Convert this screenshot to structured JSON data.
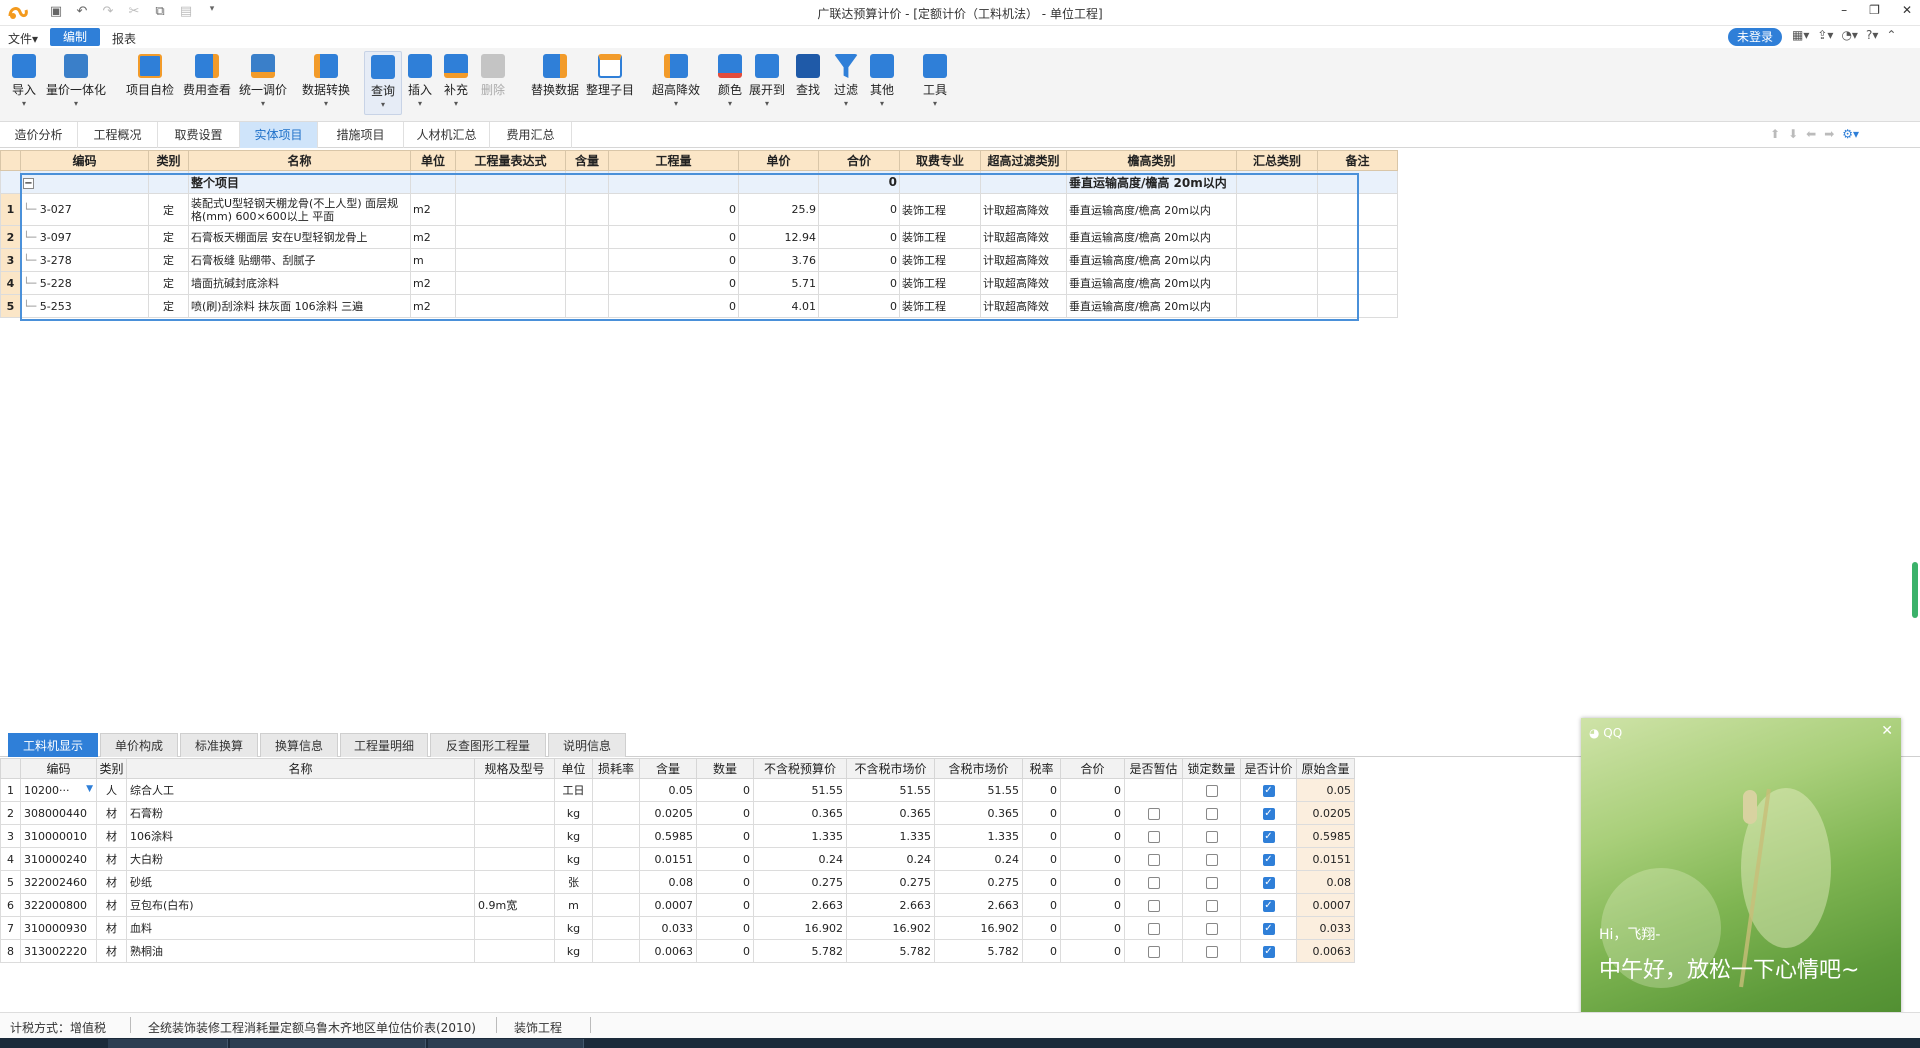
{
  "titlebar": {
    "title": "广联达预算计价 - [定额计价（工料机法） - 单位工程]",
    "min": "–",
    "max": "❐",
    "close": "✕"
  },
  "menubar": {
    "file": "文件▾",
    "edit": "编制",
    "report": "报表",
    "login": "未登录"
  },
  "toolbar": {
    "import": "导入",
    "quote": "量价一体化",
    "selfcheck": "项目自检",
    "feecheck": "费用查看",
    "unify": "统一调价",
    "convert": "数据转换",
    "query": "查询",
    "insert": "插入",
    "supplement": "补充",
    "delete": "删除",
    "replace": "替换数据",
    "organize": "整理子目",
    "superhigh": "超高降效",
    "color": "颜色",
    "expand": "展开到",
    "find": "查找",
    "filter": "过滤",
    "other": "其他",
    "tools": "工具"
  },
  "navtabs": {
    "t0": "造价分析",
    "t1": "工程概况",
    "t2": "取费设置",
    "t3": "实体项目",
    "t4": "措施项目",
    "t5": "人材机汇总",
    "t6": "费用汇总"
  },
  "main": {
    "headers": [
      "编码",
      "类别",
      "名称",
      "单位",
      "工程量表达式",
      "含量",
      "工程量",
      "单价",
      "合价",
      "取费专业",
      "超高过滤类别",
      "檐高类别",
      "汇总类别",
      "备注"
    ],
    "group": {
      "toggle": "−",
      "name": "整个项目",
      "total": "0",
      "eave": "垂直运输高度/檐高 20m以内"
    },
    "rows": [
      {
        "rn": "1",
        "code": "3-027",
        "type": "定",
        "name": "装配式U型轻钢天棚龙骨(不上人型) 面层规格(mm) 600×600以上 平面",
        "unit": "m2",
        "qty": "0",
        "price": "25.9",
        "total": "0",
        "major": "装饰工程",
        "filter": "计取超高降效",
        "eave": "垂直运输高度/檐高 20m以内"
      },
      {
        "rn": "2",
        "code": "3-097",
        "type": "定",
        "name": "石膏板天棚面层 安在U型轻钢龙骨上",
        "unit": "m2",
        "qty": "0",
        "price": "12.94",
        "total": "0",
        "major": "装饰工程",
        "filter": "计取超高降效",
        "eave": "垂直运输高度/檐高 20m以内"
      },
      {
        "rn": "3",
        "code": "3-278",
        "type": "定",
        "name": "石膏板缝 贴绷带、刮腻子",
        "unit": "m",
        "qty": "0",
        "price": "3.76",
        "total": "0",
        "major": "装饰工程",
        "filter": "计取超高降效",
        "eave": "垂直运输高度/檐高 20m以内"
      },
      {
        "rn": "4",
        "code": "5-228",
        "type": "定",
        "name": "墙面抗碱封底涂料",
        "unit": "m2",
        "qty": "0",
        "price": "5.71",
        "total": "0",
        "major": "装饰工程",
        "filter": "计取超高降效",
        "eave": "垂直运输高度/檐高 20m以内"
      },
      {
        "rn": "5",
        "code": "5-253",
        "type": "定",
        "name": "喷(刷)刮涂料 抹灰面 106涂料 三遍",
        "unit": "m2",
        "qty": "0",
        "price": "4.01",
        "total": "0",
        "major": "装饰工程",
        "filter": "计取超高降效",
        "eave": "垂直运输高度/檐高 20m以内"
      }
    ]
  },
  "bottomtabs": {
    "t0": "工料机显示",
    "t1": "单价构成",
    "t2": "标准换算",
    "t3": "换算信息",
    "t4": "工程量明细",
    "t5": "反查图形工程量",
    "t6": "说明信息"
  },
  "sub": {
    "headers": [
      "编码",
      "类别",
      "名称",
      "规格及型号",
      "单位",
      "损耗率",
      "含量",
      "数量",
      "不含税预算价",
      "不含税市场价",
      "含税市场价",
      "税率",
      "合价",
      "是否暂估",
      "锁定数量",
      "是否计价",
      "原始含量"
    ],
    "rows": [
      {
        "rn": "1",
        "code": "10200···",
        "type": "人",
        "name": "综合人工",
        "spec": "",
        "unit": "工日",
        "content": "0.05",
        "qty": "0",
        "budget": "51.55",
        "market": "51.55",
        "taxmarket": "51.55",
        "tax": "0",
        "total": "0",
        "est": null,
        "lock": false,
        "priced": true,
        "orig": "0.05"
      },
      {
        "rn": "2",
        "code": "308000440",
        "type": "材",
        "name": "石膏粉",
        "spec": "",
        "unit": "kg",
        "content": "0.0205",
        "qty": "0",
        "budget": "0.365",
        "market": "0.365",
        "taxmarket": "0.365",
        "tax": "0",
        "total": "0",
        "est": false,
        "lock": false,
        "priced": true,
        "orig": "0.0205"
      },
      {
        "rn": "3",
        "code": "310000010",
        "type": "材",
        "name": "106涂料",
        "spec": "",
        "unit": "kg",
        "content": "0.5985",
        "qty": "0",
        "budget": "1.335",
        "market": "1.335",
        "taxmarket": "1.335",
        "tax": "0",
        "total": "0",
        "est": false,
        "lock": false,
        "priced": true,
        "orig": "0.5985"
      },
      {
        "rn": "4",
        "code": "310000240",
        "type": "材",
        "name": "大白粉",
        "spec": "",
        "unit": "kg",
        "content": "0.0151",
        "qty": "0",
        "budget": "0.24",
        "market": "0.24",
        "taxmarket": "0.24",
        "tax": "0",
        "total": "0",
        "est": false,
        "lock": false,
        "priced": true,
        "orig": "0.0151"
      },
      {
        "rn": "5",
        "code": "322002460",
        "type": "材",
        "name": "砂纸",
        "spec": "",
        "unit": "张",
        "content": "0.08",
        "qty": "0",
        "budget": "0.275",
        "market": "0.275",
        "taxmarket": "0.275",
        "tax": "0",
        "total": "0",
        "est": false,
        "lock": false,
        "priced": true,
        "orig": "0.08"
      },
      {
        "rn": "6",
        "code": "322000800",
        "type": "材",
        "name": "豆包布(白布)",
        "spec": "0.9m宽",
        "unit": "m",
        "content": "0.0007",
        "qty": "0",
        "budget": "2.663",
        "market": "2.663",
        "taxmarket": "2.663",
        "tax": "0",
        "total": "0",
        "est": false,
        "lock": false,
        "priced": true,
        "orig": "0.0007"
      },
      {
        "rn": "7",
        "code": "310000930",
        "type": "材",
        "name": "血料",
        "spec": "",
        "unit": "kg",
        "content": "0.033",
        "qty": "0",
        "budget": "16.902",
        "market": "16.902",
        "taxmarket": "16.902",
        "tax": "0",
        "total": "0",
        "est": false,
        "lock": false,
        "priced": true,
        "orig": "0.033"
      },
      {
        "rn": "8",
        "code": "313002220",
        "type": "材",
        "name": "熟桐油",
        "spec": "",
        "unit": "kg",
        "content": "0.0063",
        "qty": "0",
        "budget": "5.782",
        "market": "5.782",
        "taxmarket": "5.782",
        "tax": "0",
        "total": "0",
        "est": false,
        "lock": false,
        "priced": true,
        "orig": "0.0063"
      }
    ]
  },
  "statusbar": {
    "tax": "计税方式：增值税",
    "quota": "全统装饰装修工程消耗量定额乌鲁木齐地区单位估价表(2010)",
    "major": "装饰工程"
  },
  "qq": {
    "label": "QQ",
    "close": "✕",
    "hi": "Hi，飞翔-",
    "message": "中午好，放松一下心情吧~"
  },
  "colors": {
    "accent": "#2f7fd8",
    "header_bg": "#fbe6c7",
    "group_bg": "#e9f1fb"
  }
}
